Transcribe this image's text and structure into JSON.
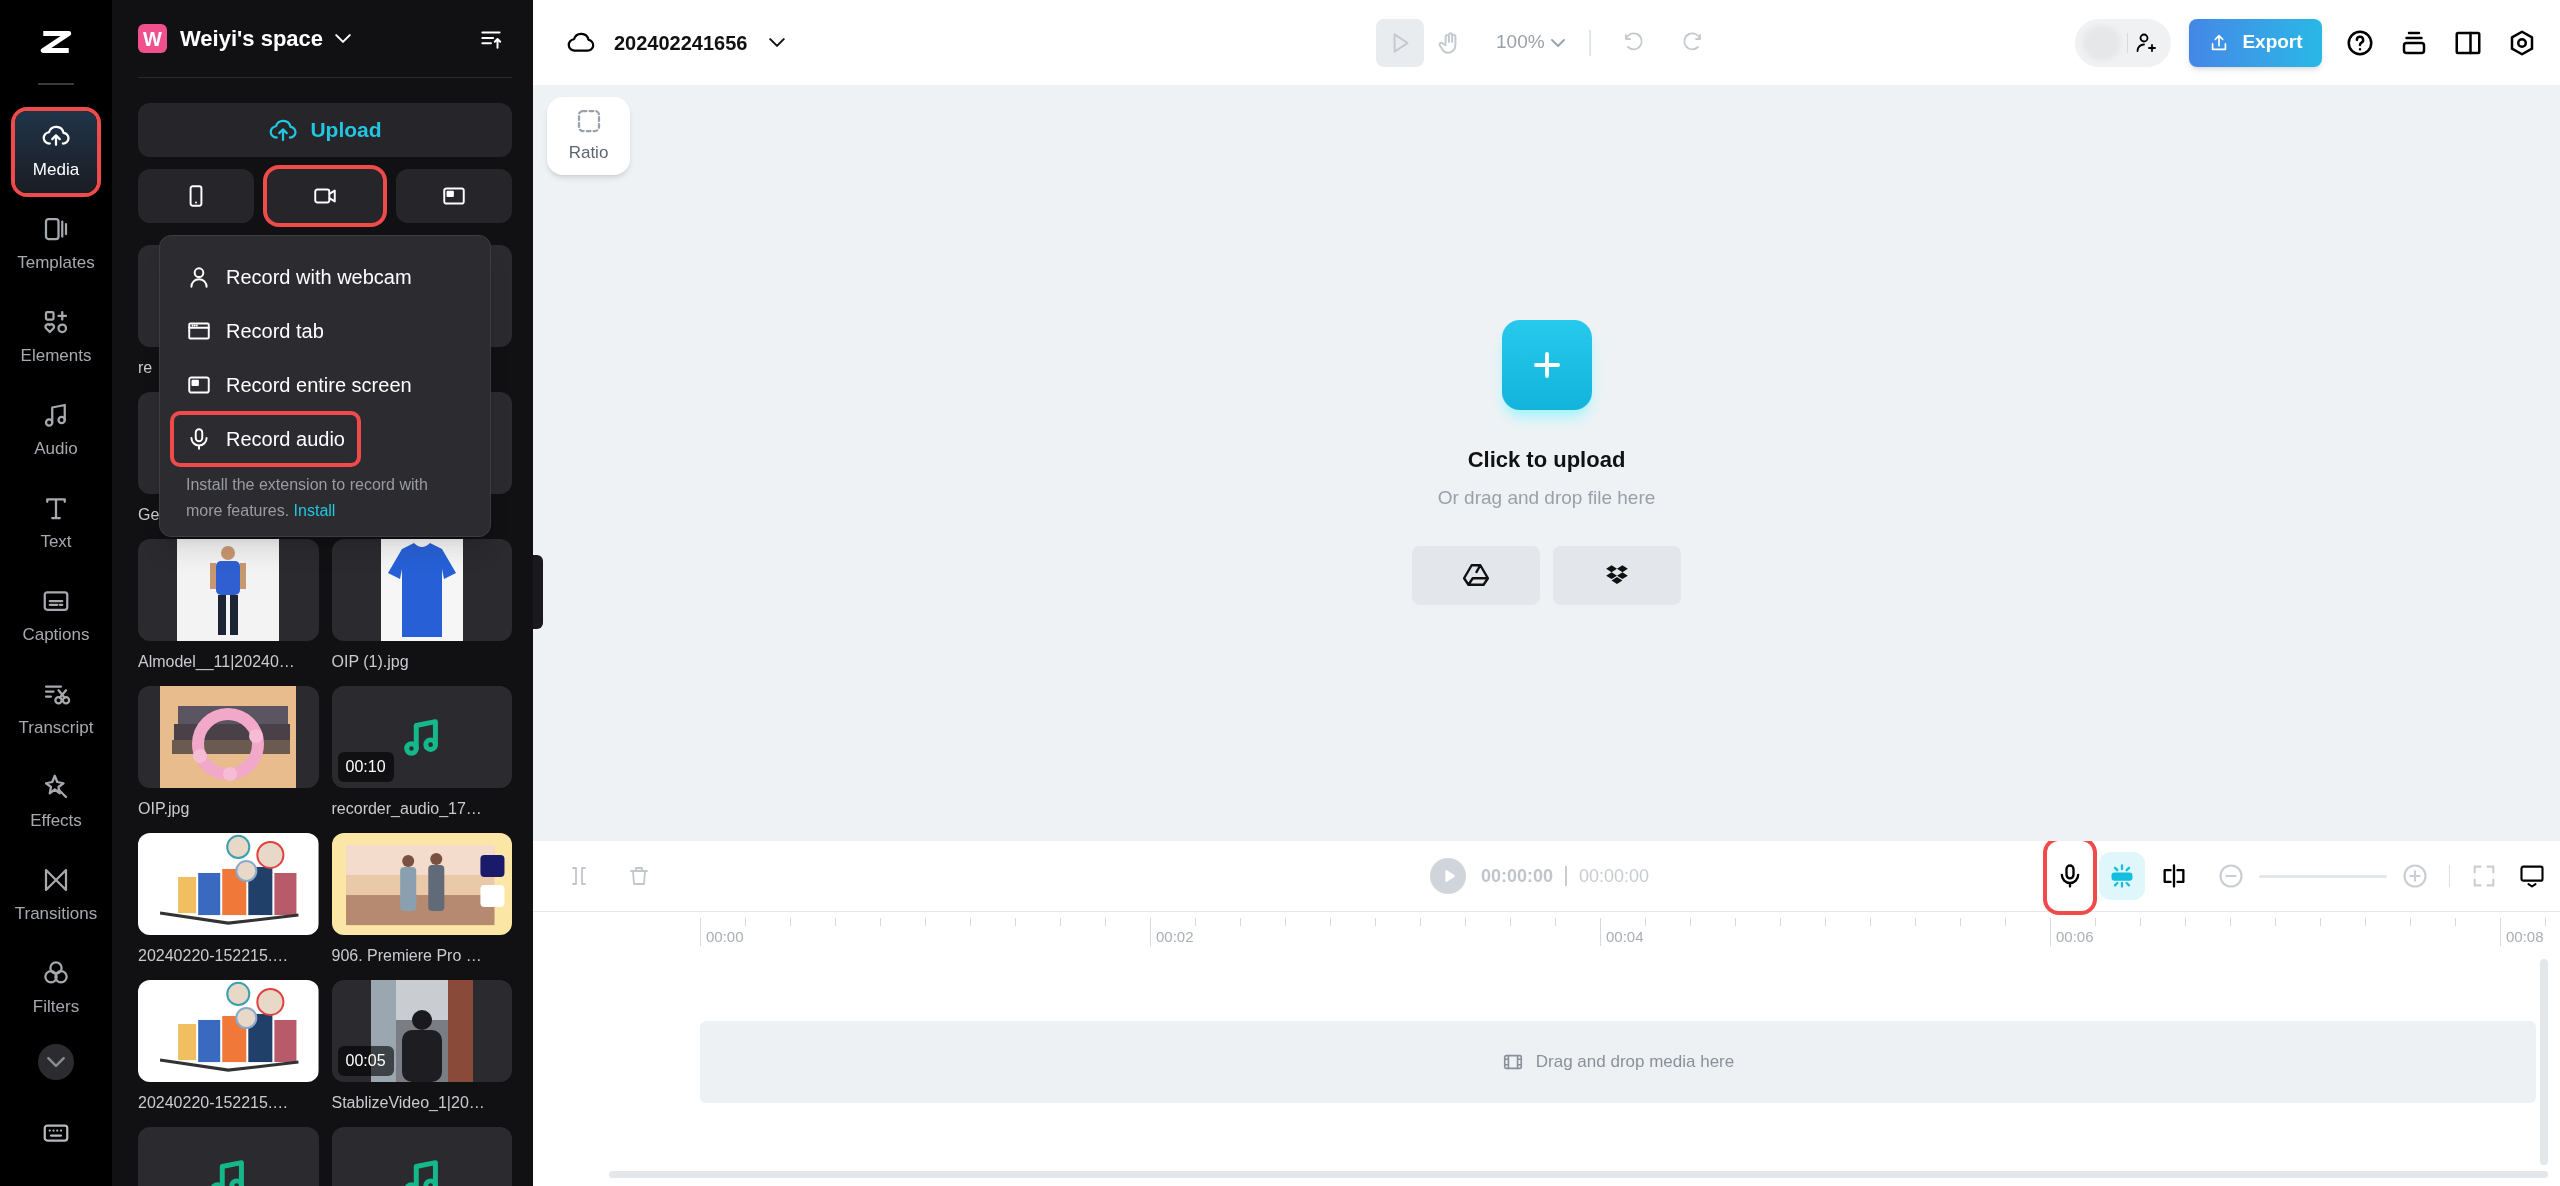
{
  "nav": {
    "items": [
      {
        "kind": "media",
        "label": "Media",
        "selected": true,
        "highlighted": true
      },
      {
        "kind": "templates",
        "label": "Templates",
        "selected": false,
        "highlighted": false
      },
      {
        "kind": "elements",
        "label": "Elements",
        "selected": false,
        "highlighted": false
      },
      {
        "kind": "audio",
        "label": "Audio",
        "selected": false,
        "highlighted": false
      },
      {
        "kind": "text",
        "label": "Text",
        "selected": false,
        "highlighted": false
      },
      {
        "kind": "captions",
        "label": "Captions",
        "selected": false,
        "highlighted": false
      },
      {
        "kind": "transcript",
        "label": "Transcript",
        "selected": false,
        "highlighted": false
      },
      {
        "kind": "effects",
        "label": "Effects",
        "selected": false,
        "highlighted": false
      },
      {
        "kind": "transitions",
        "label": "Transitions",
        "selected": false,
        "highlighted": false
      },
      {
        "kind": "filters",
        "label": "Filters",
        "selected": false,
        "highlighted": false
      }
    ]
  },
  "workspace": {
    "initial": "W",
    "name": "Weiyi's space"
  },
  "upload_button": "Upload",
  "record_buttons": [
    {
      "kind": "phone",
      "highlighted": false
    },
    {
      "kind": "camera",
      "highlighted": true
    },
    {
      "kind": "screen",
      "highlighted": false
    }
  ],
  "record_menu": {
    "items": [
      {
        "kind": "webcam",
        "label": "Record with webcam",
        "highlighted": false
      },
      {
        "kind": "tab",
        "label": "Record tab",
        "highlighted": false
      },
      {
        "kind": "screen",
        "label": "Record entire screen",
        "highlighted": false
      },
      {
        "kind": "audio",
        "label": "Record audio",
        "highlighted": true
      }
    ],
    "note": "Install the extension to record with more features.",
    "link": "Install"
  },
  "media_rows": [
    {
      "cards": [
        {
          "kind": "covered",
          "label": "re"
        },
        {
          "kind": "covered"
        }
      ]
    },
    {
      "cards": [
        {
          "kind": "covered",
          "label": "Ge"
        },
        {
          "kind": "covered"
        }
      ]
    },
    {
      "cards": [
        {
          "kind": "picture",
          "label": "Almodel__11|20240…"
        },
        {
          "kind": "picture",
          "label": "OIP (1).jpg"
        }
      ]
    },
    {
      "cards": [
        {
          "kind": "picture",
          "label": "OIP.jpg"
        },
        {
          "kind": "audio",
          "label": "recorder_audio_17…",
          "duration": "00:10"
        }
      ]
    },
    {
      "cards": [
        {
          "kind": "picture",
          "label": "20240220-152215.…"
        },
        {
          "kind": "picture",
          "label": "906. Premiere Pro …"
        }
      ]
    },
    {
      "cards": [
        {
          "kind": "picture",
          "label": "20240220-152215.…"
        },
        {
          "kind": "picture",
          "label": "StablizeVideo_1|20…",
          "duration": "00:05"
        }
      ]
    },
    {
      "cards": [
        {
          "kind": "audio"
        },
        {
          "kind": "audio"
        }
      ]
    }
  ],
  "topbar": {
    "project": "202402241656",
    "tools": [
      {
        "kind": "pointer",
        "selected": true
      },
      {
        "kind": "hand",
        "selected": false
      }
    ],
    "zoom": "100%",
    "export": "Export"
  },
  "canvas": {
    "ratio": "Ratio",
    "title": "Click to upload",
    "subtitle": "Or drag and drop file here",
    "sources": [
      {
        "kind": "drive"
      },
      {
        "kind": "dropbox"
      }
    ]
  },
  "timeline": {
    "zoom_slider": {
      "level": 0
    },
    "current": "00:00:00",
    "total": "00:00:00",
    "ruler": [
      "00:00",
      "00:02",
      "00:04",
      "00:06",
      "00:08"
    ],
    "track_hint": "Drag and drop media here",
    "tools": [
      {
        "kind": "mic",
        "highlighted": true,
        "active": false
      },
      {
        "kind": "magnet",
        "highlighted": false,
        "active": true
      },
      {
        "kind": "split",
        "highlighted": false,
        "active": false
      }
    ]
  }
}
